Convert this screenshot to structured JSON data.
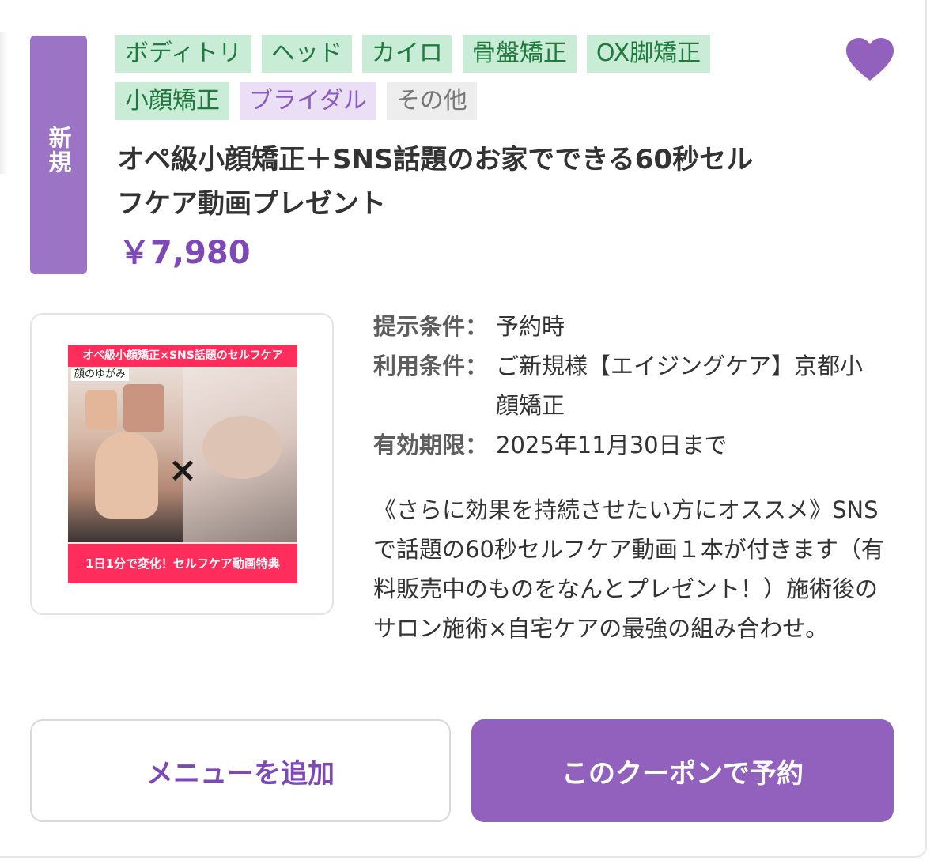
{
  "badge": {
    "new_label": "新規"
  },
  "tags": [
    {
      "label": "ボディトリ"
    },
    {
      "label": "ヘッド"
    },
    {
      "label": "カイロ"
    },
    {
      "label": "骨盤矯正"
    },
    {
      "label": "OX脚矯正"
    },
    {
      "label": "小顔矯正"
    },
    {
      "label": "ブライダル"
    },
    {
      "label": "その他"
    }
  ],
  "favorite": {
    "icon": "heart-icon",
    "color": "#9261bd"
  },
  "coupon": {
    "title_line1": "オペ級小顔矯正＋SNS話題のお家でできる60秒セル",
    "title_line2": "フケア動画プレゼント",
    "price": "￥7,980"
  },
  "thumbnail": {
    "top_banner": "オペ級小顔矯正×SNS話題のセルフケア",
    "subcaption": "顔のゆがみ",
    "cross": "×",
    "bottom_banner": "1日1分で変化！セルフケア動画特典"
  },
  "conditions": [
    {
      "label": "提示条件：",
      "value": "予約時"
    },
    {
      "label": "利用条件：",
      "value": "ご新規様【エイジングケア】京都小顔矯正"
    },
    {
      "label": "有効期限：",
      "value": "2025年11月30日まで"
    }
  ],
  "description": "《さらに効果を持続させたい方にオススメ》SNSで話題の60秒セルフケア動画１本が付きます（有料販売中のものをなんとプレゼント！）施術後のサロン施術×自宅ケアの最強の組み合わせ。",
  "actions": {
    "add_menu_label": "メニューを追加",
    "book_label": "このクーポンで予約"
  },
  "colors": {
    "accent": "#9261bd",
    "price": "#7d49b8",
    "tag_green_bg": "#c9ecd6",
    "tag_green_text": "#1e7a3e",
    "tag_purple_bg": "#eadff5",
    "tag_gray_bg": "#ededed"
  }
}
